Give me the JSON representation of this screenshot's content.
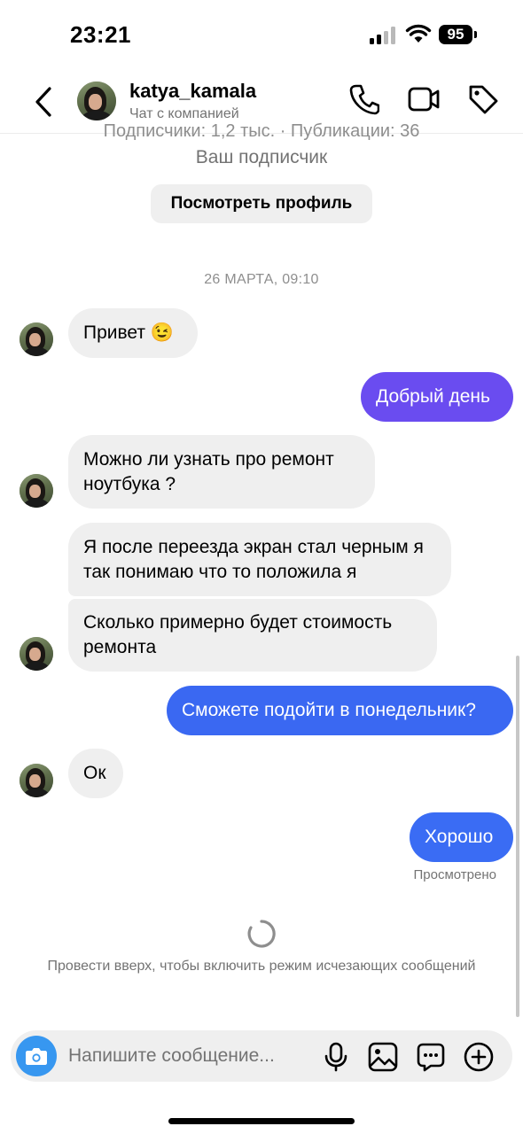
{
  "status": {
    "time": "23:21",
    "battery": "95"
  },
  "header": {
    "contact_name": "katya_kamala",
    "subtitle": "Чат с компанией",
    "icons": [
      "chevron-left-icon",
      "phone-icon",
      "video-icon",
      "tag-icon"
    ]
  },
  "profile": {
    "stats_partial": "Подписчики: 1,2 тыс. · Публикации: 36",
    "follower_label": "Ваш подписчик",
    "view_profile_button": "Посмотреть профиль"
  },
  "thread": {
    "date_separator": "26 МАРТА, 09:10",
    "messages": [
      {
        "from": "them",
        "text": "Привет 😉"
      },
      {
        "from": "me",
        "text": "Добрый день"
      },
      {
        "from": "them",
        "text": "Можно ли узнать про ремонт ноутбука ?"
      },
      {
        "from": "them",
        "text": "Я после переезда экран стал черным я так понимаю что то положила я"
      },
      {
        "from": "them",
        "text": "Сколько примерно будет стоимость ремонта"
      },
      {
        "from": "me",
        "text": "Сможете подойти в понедельник?"
      },
      {
        "from": "them",
        "text": "Ок"
      },
      {
        "from": "me",
        "text": "Хорошо"
      }
    ],
    "seen_label": "Просмотрено",
    "vanish_hint": "Провести вверх, чтобы включить режим исчезающих сообщений"
  },
  "composer": {
    "placeholder": "Напишите сообщение...",
    "icons": [
      "camera-icon",
      "microphone-icon",
      "gallery-icon",
      "sticker-icon",
      "plus-icon"
    ]
  },
  "colors": {
    "accent_blue": "#3797f0",
    "bubble_purple": "#6a4cf0",
    "bubble_blue": "#3a68f2",
    "bubble_gray": "#efefef"
  }
}
